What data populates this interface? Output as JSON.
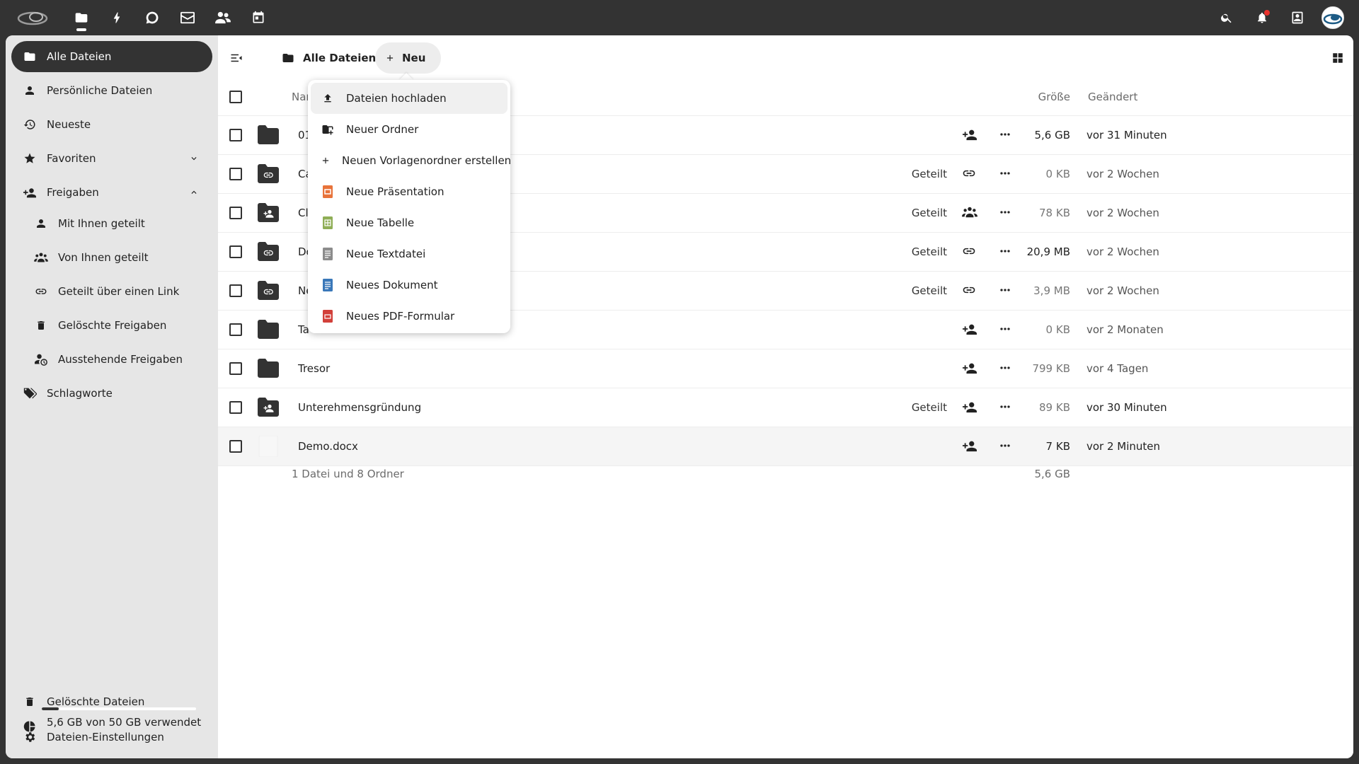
{
  "topbar": {
    "apps": [
      {
        "name": "logo"
      },
      {
        "name": "files-app",
        "active": true
      },
      {
        "name": "activity-app"
      },
      {
        "name": "talk-app"
      },
      {
        "name": "mail-app"
      },
      {
        "name": "contacts-app"
      },
      {
        "name": "calendar-app"
      }
    ],
    "right": [
      "search-icon",
      "bell-icon",
      "contacts-menu-icon",
      "avatar"
    ]
  },
  "sidebar": {
    "items": [
      {
        "label": "Alle Dateien",
        "active": true
      },
      {
        "label": "Persönliche Dateien"
      },
      {
        "label": "Neueste"
      },
      {
        "label": "Favoriten"
      },
      {
        "label": "Freigaben"
      },
      {
        "label": "Mit Ihnen geteilt"
      },
      {
        "label": "Von Ihnen geteilt"
      },
      {
        "label": "Geteilt über einen Link"
      },
      {
        "label": "Gelöschte Freigaben"
      },
      {
        "label": "Ausstehende Freigaben"
      },
      {
        "label": "Schlagworte"
      }
    ],
    "trash": "Gelöschte Dateien",
    "quota_text": "5,6 GB von 50 GB verwendet",
    "quota_fraction": 0.112,
    "settings": "Dateien-Einstellungen"
  },
  "main": {
    "breadcrumb": "Alle Dateien",
    "new_button": "Neu",
    "columns": {
      "name": "Nar",
      "size": "Größe",
      "modified": "Geändert"
    },
    "rows": [
      {
        "name": "01",
        "type": "folder",
        "shared": "",
        "share_icon": "add-user",
        "size": "5,6 GB",
        "modified": "vor 31 Minuten",
        "size_bold": true,
        "mod_bold": true
      },
      {
        "name": "Ca",
        "type": "link-folder",
        "shared": "Geteilt",
        "share_icon": "link",
        "size": "0 KB",
        "modified": "vor 2 Wochen"
      },
      {
        "name": "Cl",
        "type": "shared-folder",
        "shared": "Geteilt",
        "share_icon": "group",
        "size": "78 KB",
        "modified": "vor 2 Wochen"
      },
      {
        "name": "Do",
        "type": "link-folder",
        "shared": "Geteilt",
        "share_icon": "link",
        "size": "20,9 MB",
        "modified": "vor 2 Wochen",
        "size_bold": true
      },
      {
        "name": "Ne",
        "type": "link-folder",
        "shared": "Geteilt",
        "share_icon": "link",
        "size": "3,9 MB",
        "modified": "vor 2 Wochen"
      },
      {
        "name": "Ta",
        "type": "folder",
        "shared": "",
        "share_icon": "add-user",
        "size": "0 KB",
        "modified": "vor 2 Monaten"
      },
      {
        "name": "Tresor",
        "type": "folder",
        "shared": "",
        "share_icon": "add-user",
        "size": "799 KB",
        "modified": "vor 4 Tagen"
      },
      {
        "name": "Unterehmensgründung",
        "type": "shared-folder",
        "shared": "Geteilt",
        "share_icon": "add-user",
        "size": "89 KB",
        "modified": "vor 30 Minuten",
        "mod_bold": true
      },
      {
        "name": "Demo.docx",
        "type": "file",
        "shared": "",
        "share_icon": "add-user",
        "size": "7 KB",
        "modified": "vor 2 Minuten",
        "size_bold": true,
        "mod_bold": true,
        "hover": true
      }
    ],
    "footer_summary": "1 Datei und 8 Ordner",
    "footer_size": "5,6 GB"
  },
  "new_menu": {
    "items": [
      {
        "label": "Dateien hochladen",
        "icon": "upload-icon"
      },
      {
        "label": "Neuer Ordner",
        "icon": "folder-plus-icon"
      },
      {
        "label": "Neuen Vorlagenordner erstellen",
        "icon": "plus-icon"
      },
      {
        "label": "Neue Präsentation",
        "icon": "presentation-icon"
      },
      {
        "label": "Neue Tabelle",
        "icon": "spreadsheet-icon"
      },
      {
        "label": "Neue Textdatei",
        "icon": "textfile-icon"
      },
      {
        "label": "Neues Dokument",
        "icon": "document-icon"
      },
      {
        "label": "Neues PDF-Formular",
        "icon": "pdf-form-icon"
      }
    ]
  },
  "colors": {
    "accent": "#333333",
    "presentation": "#e8733a",
    "spreadsheet": "#8fae56",
    "textfile": "#8c8c8c",
    "document": "#3a78b9",
    "pdf": "#d2403a"
  }
}
